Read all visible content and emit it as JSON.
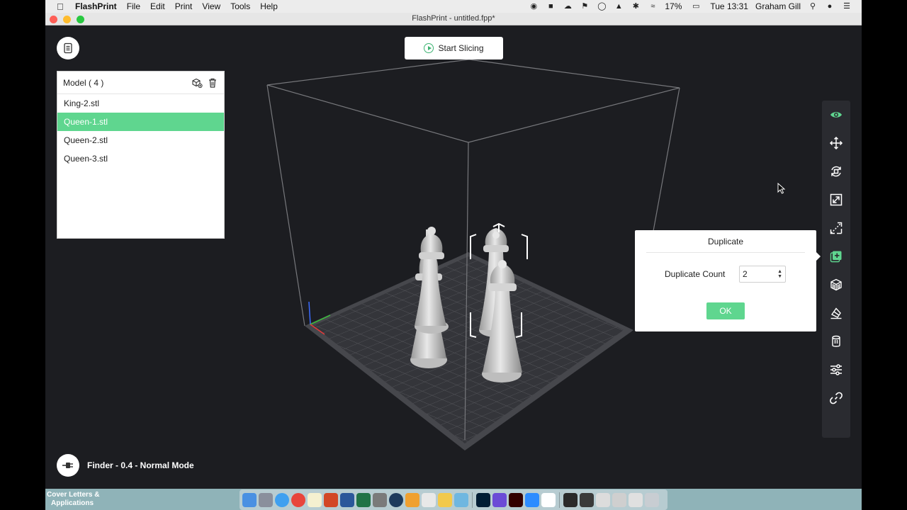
{
  "menubar": {
    "app_name": "FlashPrint",
    "menus": [
      "File",
      "Edit",
      "Print",
      "View",
      "Tools",
      "Help"
    ],
    "battery": "17%",
    "clock": "Tue 13:31",
    "user": "Graham Gill"
  },
  "window": {
    "title": "FlashPrint - untitled.fpp*"
  },
  "toolbar_top": {
    "start_slicing": "Start Slicing"
  },
  "model_panel": {
    "header": "Model ( 4 )",
    "items": [
      "King-2.stl",
      "Queen-1.stl",
      "Queen-2.stl",
      "Queen-3.stl"
    ],
    "selected_index": 1
  },
  "right_toolbar": {
    "tools": [
      "view-icon",
      "move-icon",
      "rotate-icon",
      "scale-icon",
      "cut-icon",
      "duplicate-icon",
      "supports-icon",
      "lay-flat-icon",
      "extruder-icon",
      "settings-icon",
      "link-icon"
    ],
    "active_tool": "duplicate-icon"
  },
  "duplicate_dialog": {
    "title": "Duplicate",
    "count_label": "Duplicate Count",
    "count_value": "2",
    "ok_label": "OK"
  },
  "status_bar": {
    "text": "Finder - 0.4 - Normal Mode"
  },
  "desktop": {
    "folder_label_1": "Cover Letters &",
    "folder_label_2": "Applications"
  },
  "colors": {
    "accent": "#5fd68f",
    "canvas": "#1c1d21"
  }
}
